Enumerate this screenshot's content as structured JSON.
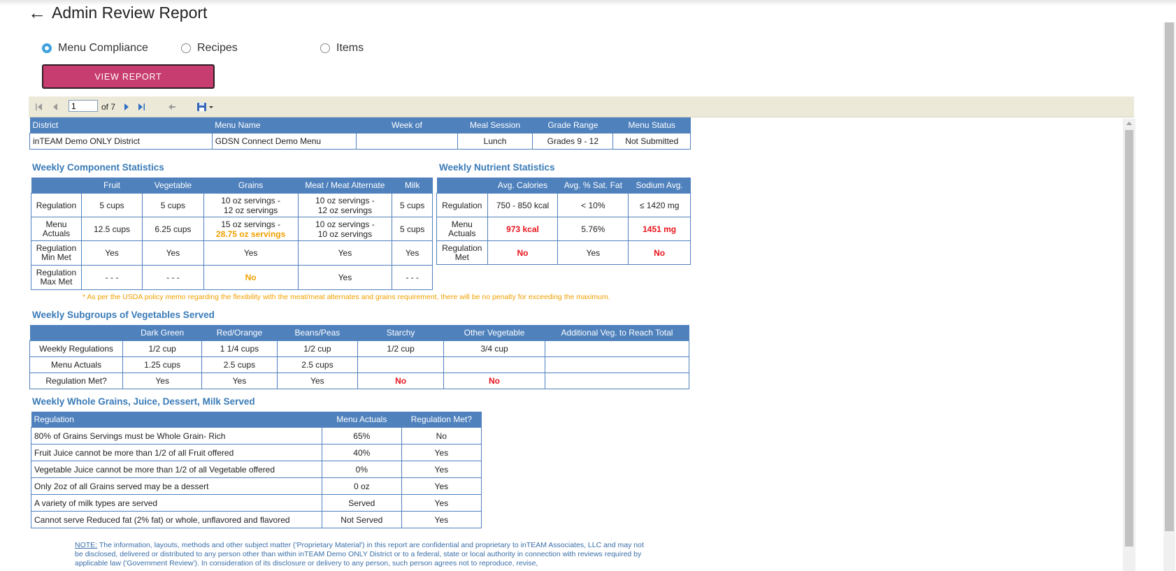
{
  "page": {
    "title": "Admin Review Report",
    "back_glyph": "←"
  },
  "report_types": [
    {
      "label": "Menu Compliance",
      "selected": true
    },
    {
      "label": "Recipes",
      "selected": false
    },
    {
      "label": "Items",
      "selected": false
    }
  ],
  "view_report_label": "VIEW REPORT",
  "toolbar": {
    "page_value": "1",
    "of_text": "of 7"
  },
  "header_table": {
    "columns": [
      "District",
      "Menu Name",
      "Week of",
      "Meal Session",
      "Grade Range",
      "Menu Status"
    ],
    "row": [
      "inTEAM Demo ONLY District",
      "GDSN Connect Demo Menu",
      "",
      "Lunch",
      "Grades 9 - 12",
      "Not Submitted"
    ]
  },
  "component_stats": {
    "title": "Weekly Component Statistics",
    "columns": [
      "",
      "Fruit",
      "Vegetable",
      "Grains",
      "Meat / Meat Alternate",
      "Milk"
    ],
    "rows": [
      {
        "label": "Regulation",
        "cells": [
          "5 cups",
          "5 cups",
          "10 oz servings -",
          "10 oz servings -",
          "5 cups"
        ],
        "cells2": [
          "",
          "",
          "12 oz servings",
          "12 oz servings",
          ""
        ]
      },
      {
        "label": "Menu Actuals",
        "cells": [
          "12.5 cups",
          "6.25 cups",
          "15 oz servings -",
          "10 oz servings -",
          "5 cups"
        ],
        "cells2": [
          "",
          "",
          "28.75 oz servings",
          "10 oz servings",
          ""
        ]
      },
      {
        "label": "Regulation Min Met",
        "cells": [
          "Yes",
          "Yes",
          "Yes",
          "Yes",
          "Yes"
        ]
      },
      {
        "label": "Regulation Max Met",
        "cells": [
          "- - -",
          "- - -",
          "No",
          "Yes",
          "- - -"
        ]
      }
    ],
    "footnote": "* As per the USDA policy memo regarding the flexibility with the meat/meat alternates and grains requirement, there will be no penalty for exceeding the maximum."
  },
  "nutrient_stats": {
    "title": "Weekly Nutrient Statistics",
    "columns": [
      "",
      "Avg. Calories",
      "Avg. % Sat. Fat",
      "Sodium Avg."
    ],
    "rows": [
      {
        "label": "Regulation",
        "cells": [
          "750 - 850 kcal",
          "< 10%",
          "≤ 1420 mg"
        ]
      },
      {
        "label": "Menu Actuals",
        "cells": [
          "973 kcal",
          "5.76%",
          "1451 mg"
        ]
      },
      {
        "label": "Regulation Met",
        "cells": [
          "No",
          "Yes",
          "No"
        ]
      }
    ]
  },
  "veg_subgroups": {
    "title": "Weekly Subgroups of Vegetables Served",
    "columns": [
      "",
      "Dark Green",
      "Red/Orange",
      "Beans/Peas",
      "Starchy",
      "Other Vegetable",
      "Additional Veg. to Reach Total"
    ],
    "rows": [
      {
        "label": "Weekly Regulations",
        "cells": [
          "1/2 cup",
          "1 1/4 cups",
          "1/2 cup",
          "1/2 cup",
          "3/4 cup",
          ""
        ]
      },
      {
        "label": "Menu Actuals",
        "cells": [
          "1.25 cups",
          "2.5 cups",
          "2.5 cups",
          "",
          "",
          ""
        ]
      },
      {
        "label": "Regulation Met?",
        "cells": [
          "Yes",
          "Yes",
          "Yes",
          "No",
          "No",
          ""
        ]
      }
    ]
  },
  "whole_grains": {
    "title": "Weekly Whole Grains, Juice, Dessert, Milk Served",
    "columns": [
      "Regulation",
      "Menu Actuals",
      "Regulation Met?"
    ],
    "rows": [
      [
        "80% of Grains Servings must be Whole Grain- Rich",
        "65%",
        "No"
      ],
      [
        "Fruit Juice cannot be more than 1/2 of all Fruit offered",
        "40%",
        "Yes"
      ],
      [
        "Vegetable Juice cannot be more than 1/2 of all Vegetable offered",
        "0%",
        "Yes"
      ],
      [
        "Only 2oz of all Grains served may be a dessert",
        "0 oz",
        "Yes"
      ],
      [
        "A variety of milk types are served",
        "Served",
        "Yes"
      ],
      [
        "Cannot serve Reduced fat (2% fat) or whole, unflavored and flavored",
        "Not Served",
        "Yes"
      ]
    ]
  },
  "footer_note": {
    "label": "NOTE:",
    "text": " The information, layouts, methods and other subject matter ('Proprietary Material') in this report are confidential and proprietary to inTEAM Associates, LLC and may not be disclosed, delivered or distributed to any person other than within inTEAM Demo ONLY District or to a federal, state or local authority in connection with reviews required by applicable law ('Government Review'). In consideration of its disclosure or delivery to any person, such person agrees not to reproduce, revise,"
  },
  "colors": {
    "header_blue": "#4f81bd",
    "section_blue": "#3a7bb8",
    "button": "#c83d6f",
    "red": "#e8141c",
    "orange": "#f0a000"
  }
}
